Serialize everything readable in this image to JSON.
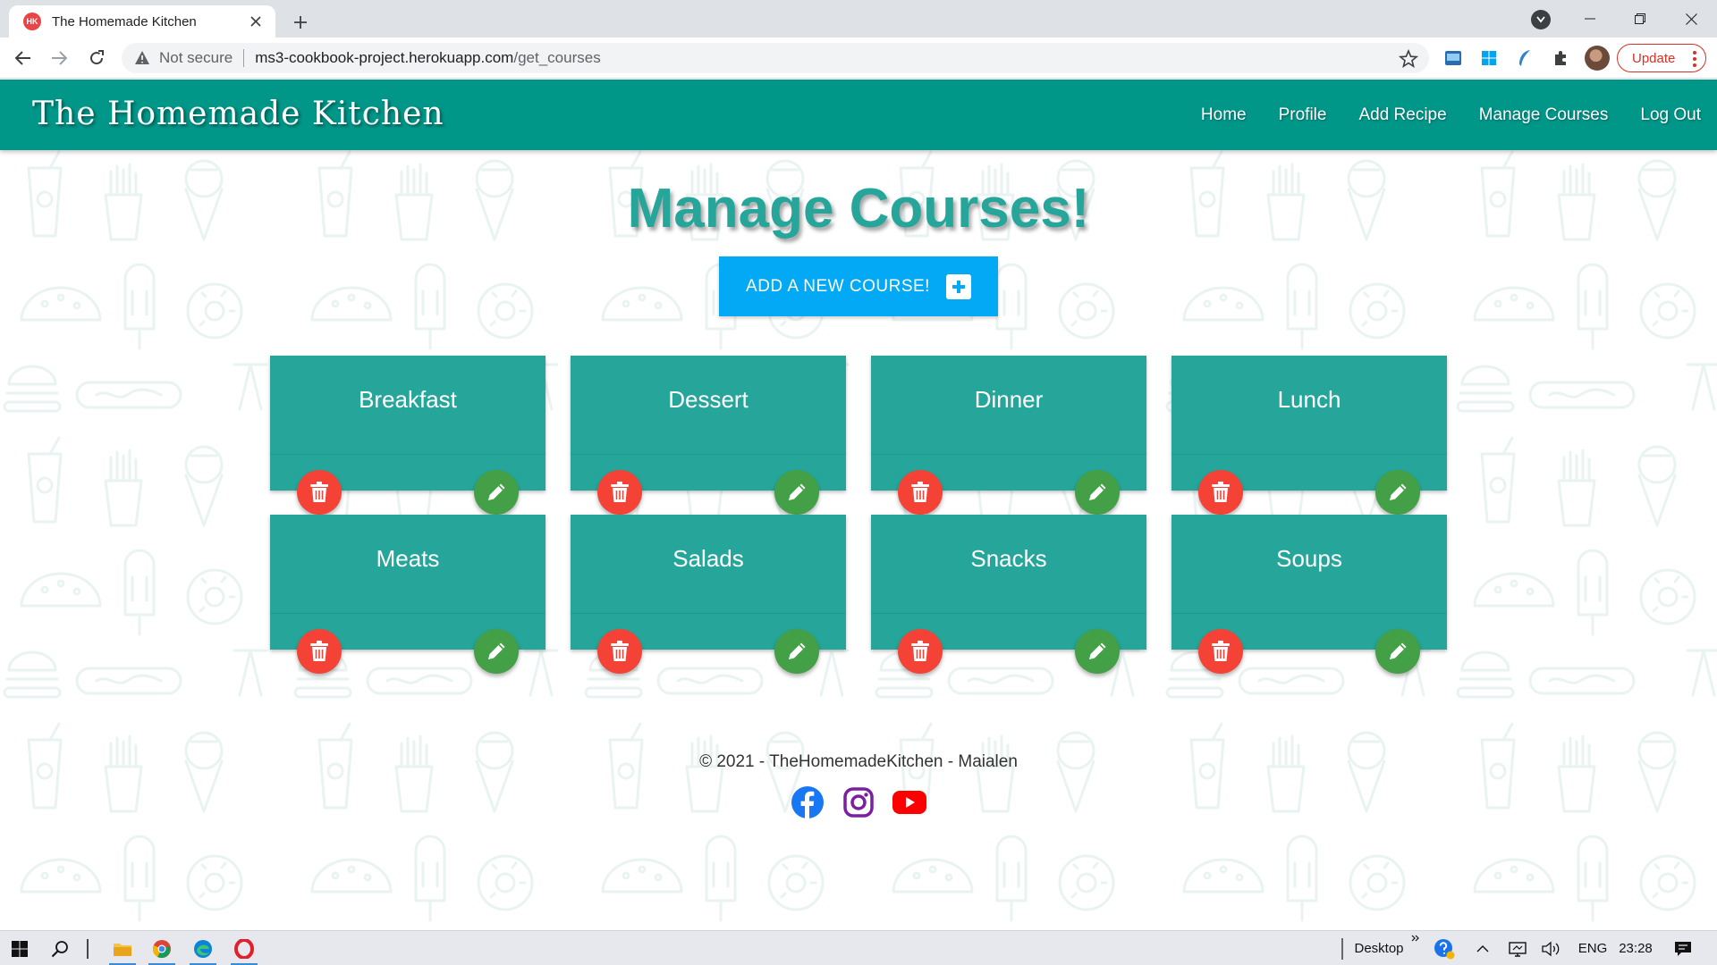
{
  "browser": {
    "tab_title": "The Homemade Kitchen",
    "favicon_text": "HK",
    "security_label": "Not secure",
    "url_host": "ms3-cookbook-project.herokuapp.com",
    "url_path": "/get_courses",
    "update_label": "Update"
  },
  "site": {
    "brand": "The Homemade Kitchen",
    "nav": [
      "Home",
      "Profile",
      "Add Recipe",
      "Manage Courses",
      "Log Out"
    ],
    "heading": "Manage Courses!",
    "add_button": "ADD A NEW COURSE!",
    "courses": [
      "Breakfast",
      "Dessert",
      "Dinner",
      "Lunch",
      "Meats",
      "Salads",
      "Snacks",
      "Soups"
    ],
    "footer": "© 2021 - TheHomemadeKitchen - Maialen",
    "social_icons": [
      "facebook-icon",
      "instagram-icon",
      "youtube-icon"
    ]
  },
  "colors": {
    "navbar": "#009688",
    "card": "#26a69a",
    "add_button": "#03a9f4",
    "delete": "#f44336",
    "edit": "#43a047"
  },
  "taskbar": {
    "desktop_label": "Desktop",
    "language": "ENG",
    "time": "23:28"
  }
}
